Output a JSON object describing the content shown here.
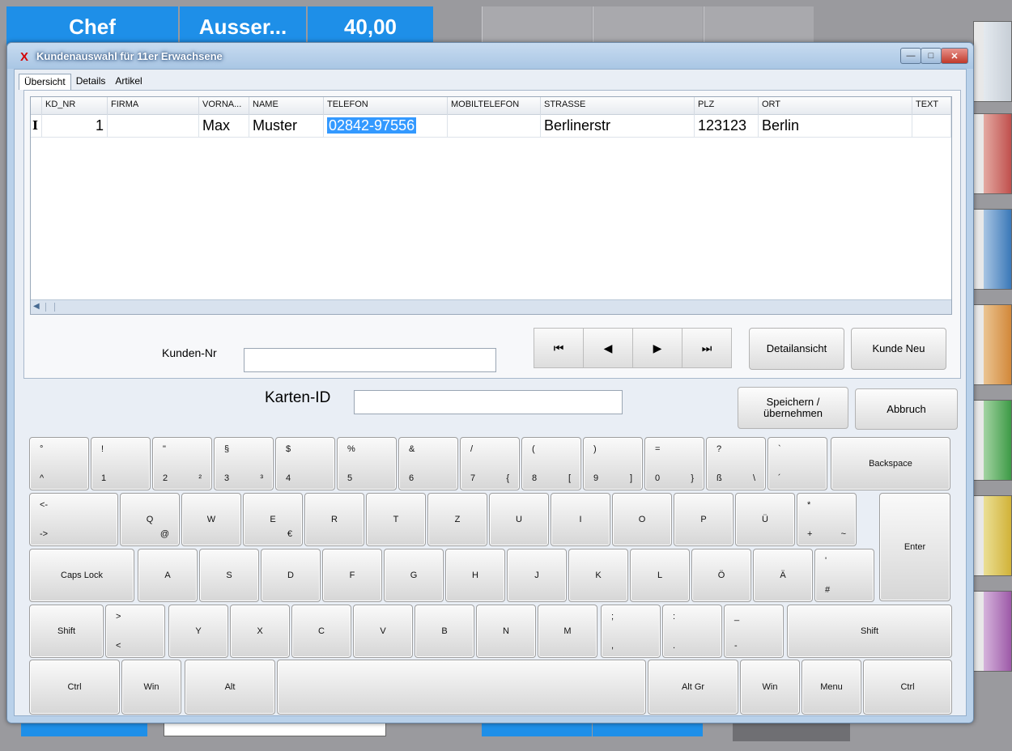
{
  "background": {
    "tiles": [
      {
        "label": "Chef"
      },
      {
        "label": "Ausser..."
      },
      {
        "label": "40,00"
      }
    ]
  },
  "window": {
    "title": "Kundenauswahl für 11er Erwachsene",
    "icon": "app-x-icon",
    "controls": {
      "minimize": "—",
      "maximize": "□",
      "close": "✕"
    }
  },
  "tabs": [
    {
      "label": "Übersicht",
      "active": true
    },
    {
      "label": "Details",
      "active": false
    },
    {
      "label": "Artikel",
      "active": false
    }
  ],
  "grid": {
    "columns": [
      "KD_NR",
      "FIRMA",
      "VORNA...",
      "NAME",
      "TELEFON",
      "MOBILTELEFON",
      "STRASSE",
      "PLZ",
      "ORT",
      "TEXT"
    ],
    "row_indicator": "I",
    "rows": [
      {
        "kd_nr": "1",
        "firma": "",
        "vorname": "Max",
        "name": "Muster",
        "telefon": "02842-97556",
        "mobiltelefon": "",
        "strasse": "Berlinerstr",
        "plz": "123123",
        "ort": "Berlin",
        "text": ""
      }
    ],
    "selected_cell": "telefon"
  },
  "form": {
    "kunden_nr_label": "Kunden-Nr",
    "kunden_nr_value": "",
    "karten_id_label": "Karten-ID",
    "karten_id_value": ""
  },
  "nav": {
    "first": "⏮",
    "prev": "◀",
    "next": "▶",
    "last": "⏭"
  },
  "buttons": {
    "detailansicht": "Detailansicht",
    "kunde_neu": "Kunde Neu",
    "speichern_line1": "Speichern /",
    "speichern_line2": "übernehmen",
    "abbruch": "Abbruch"
  },
  "keyboard": {
    "row1": [
      {
        "top": "°",
        "bot": "^"
      },
      {
        "top": "!",
        "bot": "1"
      },
      {
        "top": "\"",
        "bot": "2",
        "alt": "²"
      },
      {
        "top": "§",
        "bot": "3",
        "alt": "³"
      },
      {
        "top": "$",
        "bot": "4"
      },
      {
        "top": "%",
        "bot": "5"
      },
      {
        "top": "&",
        "bot": "6"
      },
      {
        "top": "/",
        "bot": "7",
        "alt": "{"
      },
      {
        "top": "(",
        "bot": "8",
        "alt": "["
      },
      {
        "top": ")",
        "bot": "9",
        "alt": "]"
      },
      {
        "top": "=",
        "bot": "0",
        "alt": "}"
      },
      {
        "top": "?",
        "bot": "ß",
        "alt": "\\"
      },
      {
        "top": "`",
        "bot": "´"
      }
    ],
    "backspace": "Backspace",
    "tab_top": "<-",
    "tab_bot": "->",
    "row2": [
      {
        "label": "Q",
        "alt": "@"
      },
      {
        "label": "W"
      },
      {
        "label": "E",
        "alt": "€"
      },
      {
        "label": "R"
      },
      {
        "label": "T"
      },
      {
        "label": "Z"
      },
      {
        "label": "U"
      },
      {
        "label": "I"
      },
      {
        "label": "O"
      },
      {
        "label": "P"
      },
      {
        "label": "Ü"
      }
    ],
    "plus_key": {
      "top": "*",
      "bot": "+",
      "alt": "~"
    },
    "enter": "Enter",
    "caps_lock": "Caps Lock",
    "row3": [
      "A",
      "S",
      "D",
      "F",
      "G",
      "H",
      "J",
      "K",
      "L",
      "Ö",
      "Ä"
    ],
    "hash_key": {
      "top": "'",
      "bot": "#"
    },
    "shift": "Shift",
    "angle_key": {
      "top": ">",
      "bot": "<"
    },
    "row4": [
      {
        "label": "Y"
      },
      {
        "label": "X"
      },
      {
        "label": "C"
      },
      {
        "label": "V"
      },
      {
        "label": "B"
      },
      {
        "label": "N"
      },
      {
        "label": "M"
      }
    ],
    "punct": [
      {
        "top": ";",
        "bot": ","
      },
      {
        "top": ":",
        "bot": "."
      },
      {
        "top": "_",
        "bot": "-"
      }
    ],
    "bottom": {
      "ctrl": "Ctrl",
      "win": "Win",
      "alt": "Alt",
      "alt_gr": "Alt Gr",
      "menu": "Menu"
    }
  }
}
